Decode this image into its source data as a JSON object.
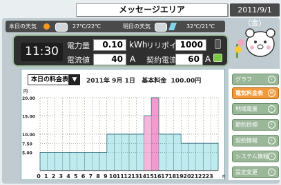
{
  "header": {
    "title": "メッセージエリア",
    "date": "2011/9/1（金）"
  },
  "weather": {
    "today_label": "本日の天気",
    "today_temp": "27℃/22℃",
    "tomorrow_label": "明日の天気",
    "tomorrow_temp": "32℃/21℃"
  },
  "status": {
    "time": "11:30",
    "power_label": "電力量",
    "power_value": "0.10",
    "power_unit": "kWh",
    "points_label": "リリポイント",
    "points_value": "1000",
    "current_label": "電流値",
    "current_value": "40",
    "current_unit": "A",
    "contract_label": "契約電流",
    "contract_value": "60",
    "contract_unit": "A"
  },
  "chart_header": {
    "select_value": "本日の料金表",
    "date_text": "2011年 9月 1日",
    "base_label": "基本料金",
    "base_value": "100.00円"
  },
  "sidebar": {
    "items": [
      {
        "label": "グラフ",
        "active": false
      },
      {
        "label": "電気料金表",
        "active": true
      },
      {
        "label": "地域電量",
        "active": false
      },
      {
        "label": "節約目標",
        "active": false
      },
      {
        "label": "契約情報",
        "active": false
      },
      {
        "label": "システム情報",
        "active": false
      },
      {
        "label": "設定変更",
        "active": false
      }
    ]
  },
  "chart_data": {
    "type": "bar",
    "ylabel": "円",
    "yticks": [
      "20.00",
      "15.00",
      "10.00",
      "7.50",
      "5.00"
    ],
    "ylim": [
      0,
      20
    ],
    "xlabel": "時",
    "categories": [
      "0",
      "1",
      "2",
      "3",
      "4",
      "5",
      "6",
      "7",
      "8",
      "9",
      "10",
      "11",
      "12",
      "13",
      "14",
      "15",
      "16",
      "17",
      "18",
      "19",
      "20",
      "21",
      "22",
      "23"
    ],
    "series": [
      {
        "values": [
          5,
          5,
          5,
          5,
          5,
          5,
          5,
          5,
          5,
          10,
          10,
          10,
          10,
          10,
          15,
          20,
          10,
          10,
          10,
          7.5,
          7.5,
          7.5,
          7.5,
          7.5
        ]
      }
    ],
    "colors": {
      "base": "#bfeaf0",
      "peak": "#f39ad0"
    },
    "grid": true
  }
}
